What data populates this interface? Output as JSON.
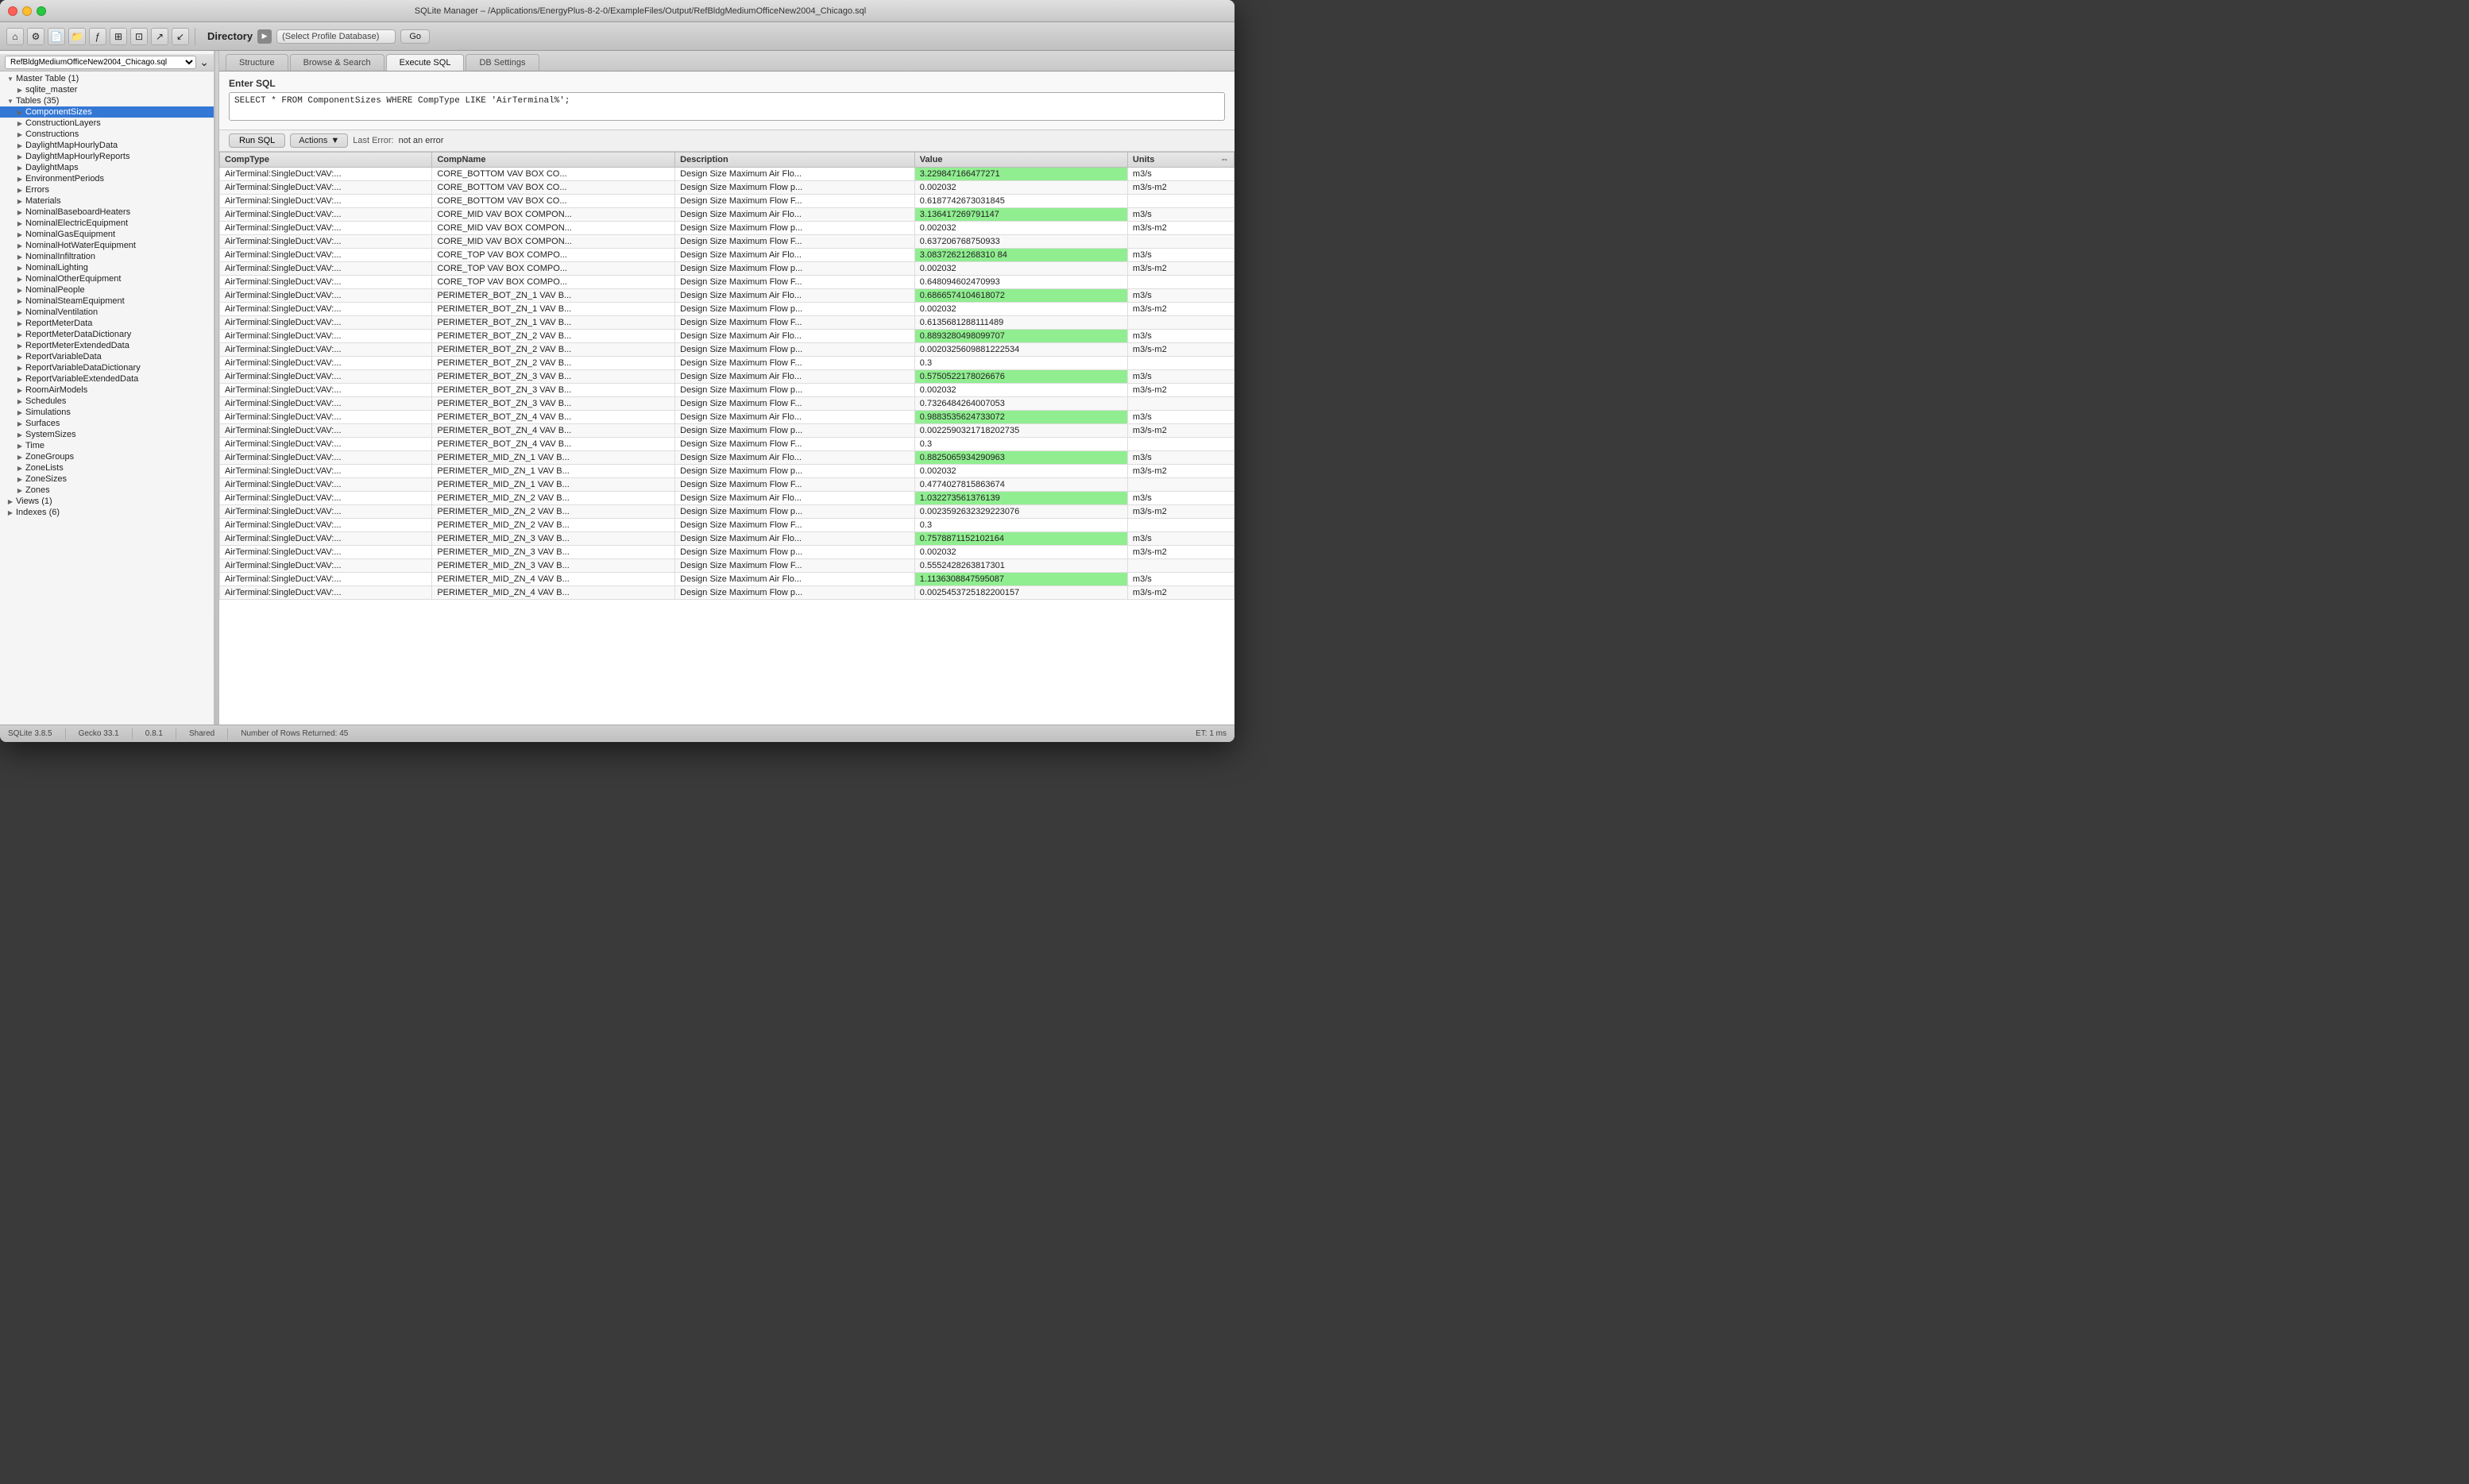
{
  "window": {
    "title": "SQLite Manager – /Applications/EnergyPlus-8-2-0/ExampleFiles/Output/RefBldgMediumOfficeNew2004_Chicago.sql"
  },
  "toolbar": {
    "directory_label": "Directory",
    "db_select_placeholder": "(Select Profile Database)",
    "go_label": "Go"
  },
  "sidebar": {
    "db_name": "RefBldgMediumOfficeNew2004_Chicago.sql",
    "master_table": "Master Table (1)",
    "master_items": [
      "sqlite_master"
    ],
    "tables_section": "Tables (35)",
    "tables": [
      "ComponentSizes",
      "ConstructionLayers",
      "Constructions",
      "DaylightMapHourlyData",
      "DaylightMapHourlyReports",
      "DaylightMaps",
      "EnvironmentPeriods",
      "Errors",
      "Materials",
      "NominalBaseboardHeaters",
      "NominalElectricEquipment",
      "NominalGasEquipment",
      "NominalHotWaterEquipment",
      "NominalInfiltration",
      "NominalLighting",
      "NominalOtherEquipment",
      "NominalPeople",
      "NominalSteamEquipment",
      "NominalVentilation",
      "ReportMeterData",
      "ReportMeterDataDictionary",
      "ReportMeterExtendedData",
      "ReportVariableData",
      "ReportVariableDataDictionary",
      "ReportVariableExtendedData",
      "RoomAirModels",
      "Schedules",
      "Simulations",
      "Surfaces",
      "SystemSizes",
      "Time",
      "ZoneGroups",
      "ZoneLists",
      "ZoneSizes",
      "Zones"
    ],
    "views_section": "Views (1)",
    "indexes_section": "Indexes (6)"
  },
  "tabs": {
    "structure": "Structure",
    "browse_search": "Browse & Search",
    "execute_sql": "Execute SQL",
    "db_settings": "DB Settings"
  },
  "sql_panel": {
    "label": "Enter SQL",
    "query": "SELECT * FROM ComponentSizes WHERE CompType LIKE 'AirTerminal%';",
    "run_button": "Run SQL",
    "actions_button": "Actions",
    "last_error_label": "Last Error:",
    "last_error_value": "not an error"
  },
  "table": {
    "columns": [
      "CompType",
      "CompName",
      "Description",
      "Value",
      "Units"
    ],
    "rows": [
      [
        "AirTerminal:SingleDuct:VAV:...",
        "CORE_BOTTOM VAV BOX CO...",
        "Design Size Maximum Air Flo...",
        "3.229847166477271",
        "m3/s"
      ],
      [
        "AirTerminal:SingleDuct:VAV:...",
        "CORE_BOTTOM VAV BOX CO...",
        "Design Size Maximum Flow p...",
        "0.002032",
        "m3/s-m2"
      ],
      [
        "AirTerminal:SingleDuct:VAV:...",
        "CORE_BOTTOM VAV BOX CO...",
        "Design Size Maximum Flow F...",
        "0.6187742673031845",
        ""
      ],
      [
        "AirTerminal:SingleDuct:VAV:...",
        "CORE_MID VAV BOX COMPON...",
        "Design Size Maximum Air Flo...",
        "3.136417269791147",
        "m3/s"
      ],
      [
        "AirTerminal:SingleDuct:VAV:...",
        "CORE_MID VAV BOX COMPON...",
        "Design Size Maximum Flow p...",
        "0.002032",
        "m3/s-m2"
      ],
      [
        "AirTerminal:SingleDuct:VAV:...",
        "CORE_MID VAV BOX COMPON...",
        "Design Size Maximum Flow F...",
        "0.637206768750933",
        ""
      ],
      [
        "AirTerminal:SingleDuct:VAV:...",
        "CORE_TOP VAV BOX COMPO...",
        "Design Size Maximum Air Flo...",
        "3.08372621268310 84",
        "m3/s"
      ],
      [
        "AirTerminal:SingleDuct:VAV:...",
        "CORE_TOP VAV BOX COMPO...",
        "Design Size Maximum Flow p...",
        "0.002032",
        "m3/s-m2"
      ],
      [
        "AirTerminal:SingleDuct:VAV:...",
        "CORE_TOP VAV BOX COMPO...",
        "Design Size Maximum Flow F...",
        "0.648094602470993",
        ""
      ],
      [
        "AirTerminal:SingleDuct:VAV:...",
        "PERIMETER_BOT_ZN_1 VAV B...",
        "Design Size Maximum Air Flo...",
        "0.6866574104618072",
        "m3/s"
      ],
      [
        "AirTerminal:SingleDuct:VAV:...",
        "PERIMETER_BOT_ZN_1 VAV B...",
        "Design Size Maximum Flow p...",
        "0.002032",
        "m3/s-m2"
      ],
      [
        "AirTerminal:SingleDuct:VAV:...",
        "PERIMETER_BOT_ZN_1 VAV B...",
        "Design Size Maximum Flow F...",
        "0.6135681288111489",
        ""
      ],
      [
        "AirTerminal:SingleDuct:VAV:...",
        "PERIMETER_BOT_ZN_2 VAV B...",
        "Design Size Maximum Air Flo...",
        "0.8893280498099707",
        "m3/s"
      ],
      [
        "AirTerminal:SingleDuct:VAV:...",
        "PERIMETER_BOT_ZN_2 VAV B...",
        "Design Size Maximum Flow p...",
        "0.0020325609881222534",
        "m3/s-m2"
      ],
      [
        "AirTerminal:SingleDuct:VAV:...",
        "PERIMETER_BOT_ZN_2 VAV B...",
        "Design Size Maximum Flow F...",
        "0.3",
        ""
      ],
      [
        "AirTerminal:SingleDuct:VAV:...",
        "PERIMETER_BOT_ZN_3 VAV B...",
        "Design Size Maximum Air Flo...",
        "0.5750522178026676",
        "m3/s"
      ],
      [
        "AirTerminal:SingleDuct:VAV:...",
        "PERIMETER_BOT_ZN_3 VAV B...",
        "Design Size Maximum Flow p...",
        "0.002032",
        "m3/s-m2"
      ],
      [
        "AirTerminal:SingleDuct:VAV:...",
        "PERIMETER_BOT_ZN_3 VAV B...",
        "Design Size Maximum Flow F...",
        "0.7326484264007053",
        ""
      ],
      [
        "AirTerminal:SingleDuct:VAV:...",
        "PERIMETER_BOT_ZN_4 VAV B...",
        "Design Size Maximum Air Flo...",
        "0.9883535624733072",
        "m3/s"
      ],
      [
        "AirTerminal:SingleDuct:VAV:...",
        "PERIMETER_BOT_ZN_4 VAV B...",
        "Design Size Maximum Flow p...",
        "0.0022590321718202735",
        "m3/s-m2"
      ],
      [
        "AirTerminal:SingleDuct:VAV:...",
        "PERIMETER_BOT_ZN_4 VAV B...",
        "Design Size Maximum Flow F...",
        "0.3",
        ""
      ],
      [
        "AirTerminal:SingleDuct:VAV:...",
        "PERIMETER_MID_ZN_1 VAV B...",
        "Design Size Maximum Air Flo...",
        "0.8825065934290963",
        "m3/s"
      ],
      [
        "AirTerminal:SingleDuct:VAV:...",
        "PERIMETER_MID_ZN_1 VAV B...",
        "Design Size Maximum Flow p...",
        "0.002032",
        "m3/s-m2"
      ],
      [
        "AirTerminal:SingleDuct:VAV:...",
        "PERIMETER_MID_ZN_1 VAV B...",
        "Design Size Maximum Flow F...",
        "0.4774027815863674",
        ""
      ],
      [
        "AirTerminal:SingleDuct:VAV:...",
        "PERIMETER_MID_ZN_2 VAV B...",
        "Design Size Maximum Air Flo...",
        "1.032273561376139",
        "m3/s"
      ],
      [
        "AirTerminal:SingleDuct:VAV:...",
        "PERIMETER_MID_ZN_2 VAV B...",
        "Design Size Maximum Flow p...",
        "0.0023592632329223076",
        "m3/s-m2"
      ],
      [
        "AirTerminal:SingleDuct:VAV:...",
        "PERIMETER_MID_ZN_2 VAV B...",
        "Design Size Maximum Flow F...",
        "0.3",
        ""
      ],
      [
        "AirTerminal:SingleDuct:VAV:...",
        "PERIMETER_MID_ZN_3 VAV B...",
        "Design Size Maximum Air Flo...",
        "0.7578871152102164",
        "m3/s"
      ],
      [
        "AirTerminal:SingleDuct:VAV:...",
        "PERIMETER_MID_ZN_3 VAV B...",
        "Design Size Maximum Flow p...",
        "0.002032",
        "m3/s-m2"
      ],
      [
        "AirTerminal:SingleDuct:VAV:...",
        "PERIMETER_MID_ZN_3 VAV B...",
        "Design Size Maximum Flow F...",
        "0.5552428263817301",
        ""
      ],
      [
        "AirTerminal:SingleDuct:VAV:...",
        "PERIMETER_MID_ZN_4 VAV B...",
        "Design Size Maximum Air Flo...",
        "1.1136308847595087",
        "m3/s"
      ],
      [
        "AirTerminal:SingleDuct:VAV:...",
        "PERIMETER_MID_ZN_4 VAV B...",
        "Design Size Maximum Flow p...",
        "0.0025453725182200157",
        "m3/s-m2"
      ]
    ],
    "green_value_indices": [
      0,
      3,
      6,
      9,
      12,
      15,
      18,
      21,
      24,
      27,
      30
    ],
    "special_indices": [
      2,
      5,
      8,
      11,
      14,
      17,
      20,
      23,
      26,
      29
    ]
  },
  "status_bar": {
    "sqlite_version": "SQLite 3.8.5",
    "gecko_version": "Gecko 33.1",
    "version": "0.8.1",
    "mode": "Shared",
    "rows_returned": "Number of Rows Returned: 45",
    "exec_time": "ET: 1 ms"
  }
}
